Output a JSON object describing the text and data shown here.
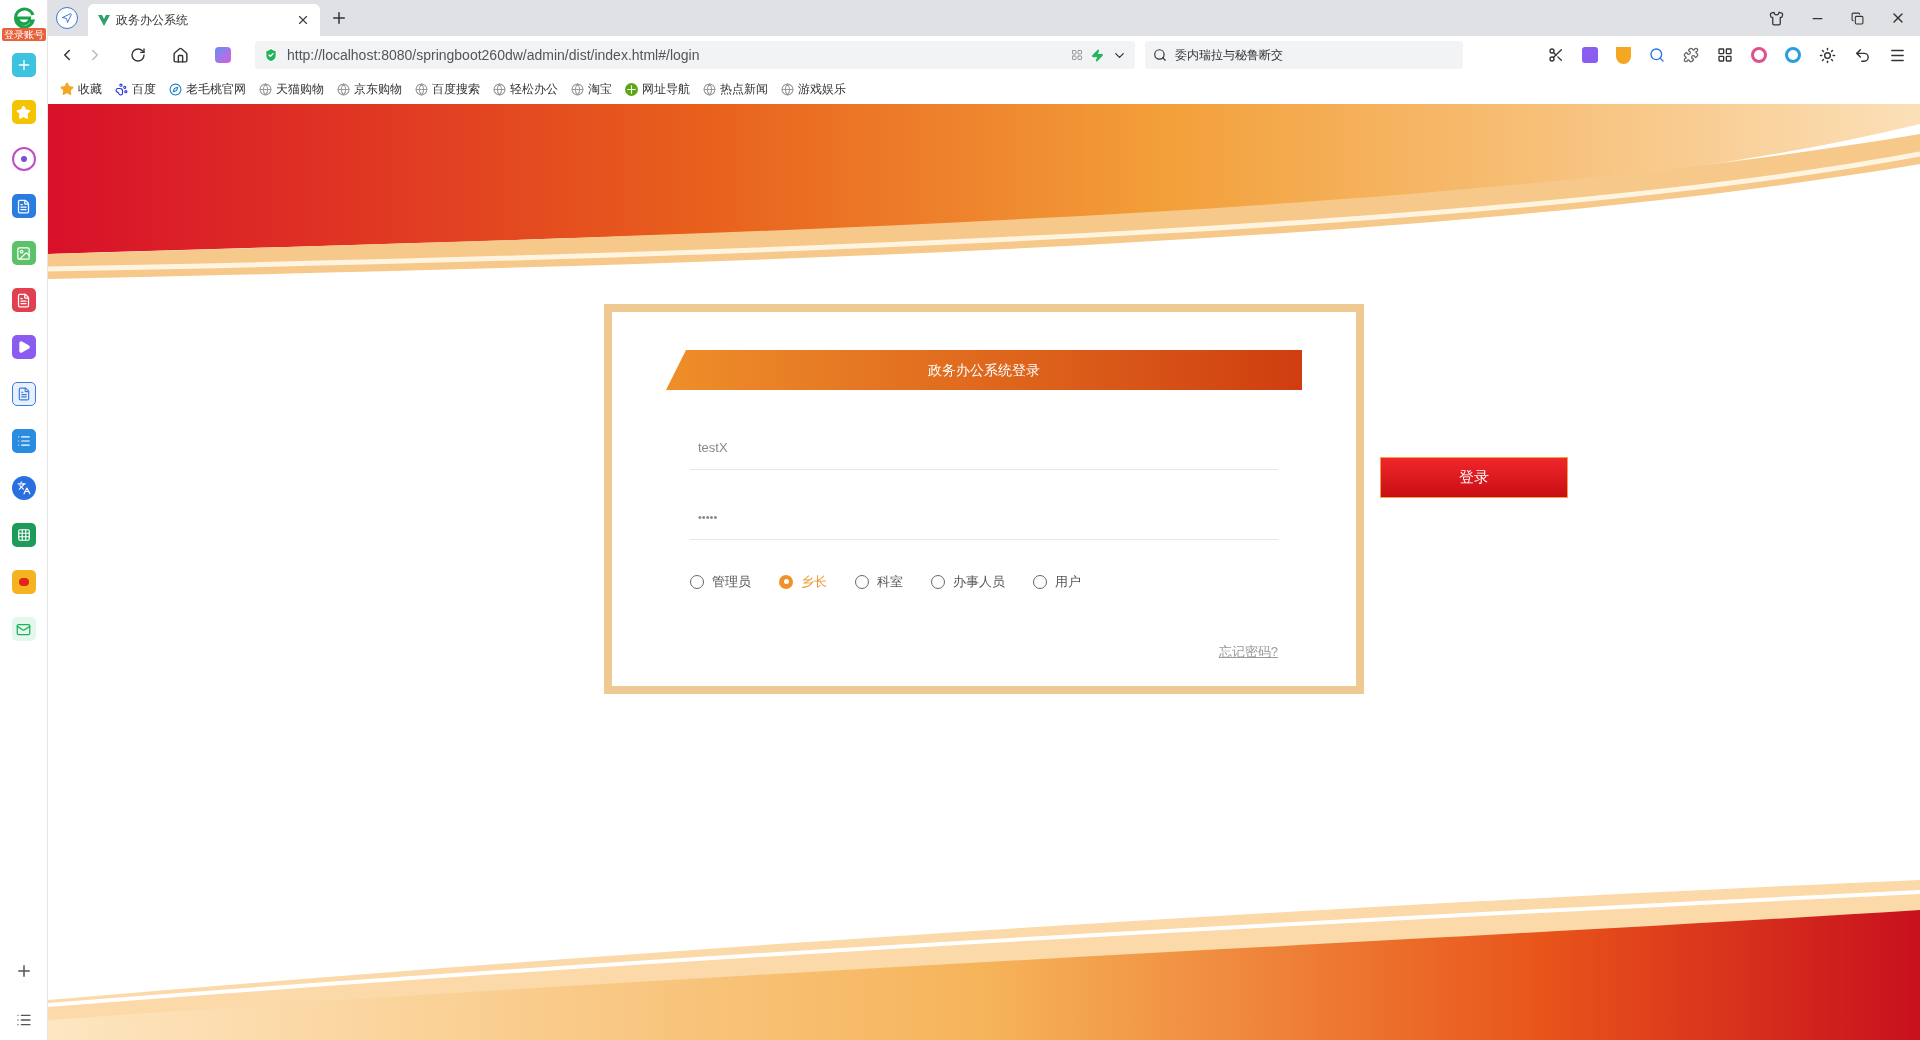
{
  "sidebar": {
    "badge": "登录账号"
  },
  "tab": {
    "title": "政务办公系统"
  },
  "address_bar": {
    "url": "http://localhost:8080/springboot260dw/admin/dist/index.html#/login",
    "search": "委内瑞拉与秘鲁断交"
  },
  "bookmarks": [
    {
      "label": "收藏",
      "kind": "star"
    },
    {
      "label": "百度",
      "kind": "paw"
    },
    {
      "label": "老毛桃官网",
      "kind": "site"
    },
    {
      "label": "天猫购物",
      "kind": "globe"
    },
    {
      "label": "京东购物",
      "kind": "globe"
    },
    {
      "label": "百度搜索",
      "kind": "globe"
    },
    {
      "label": "轻松办公",
      "kind": "globe"
    },
    {
      "label": "淘宝",
      "kind": "globe"
    },
    {
      "label": "网址导航",
      "kind": "nav"
    },
    {
      "label": "热点新闻",
      "kind": "globe"
    },
    {
      "label": "游戏娱乐",
      "kind": "globe"
    }
  ],
  "login": {
    "title": "政务办公系统登录",
    "username": "testX",
    "password": "•••••",
    "roles": [
      {
        "label": "管理员",
        "selected": false
      },
      {
        "label": "乡长",
        "selected": true
      },
      {
        "label": "科室",
        "selected": false
      },
      {
        "label": "办事人员",
        "selected": false
      },
      {
        "label": "用户",
        "selected": false
      }
    ],
    "forgot_link": "忘记密码?",
    "submit": "登录"
  }
}
